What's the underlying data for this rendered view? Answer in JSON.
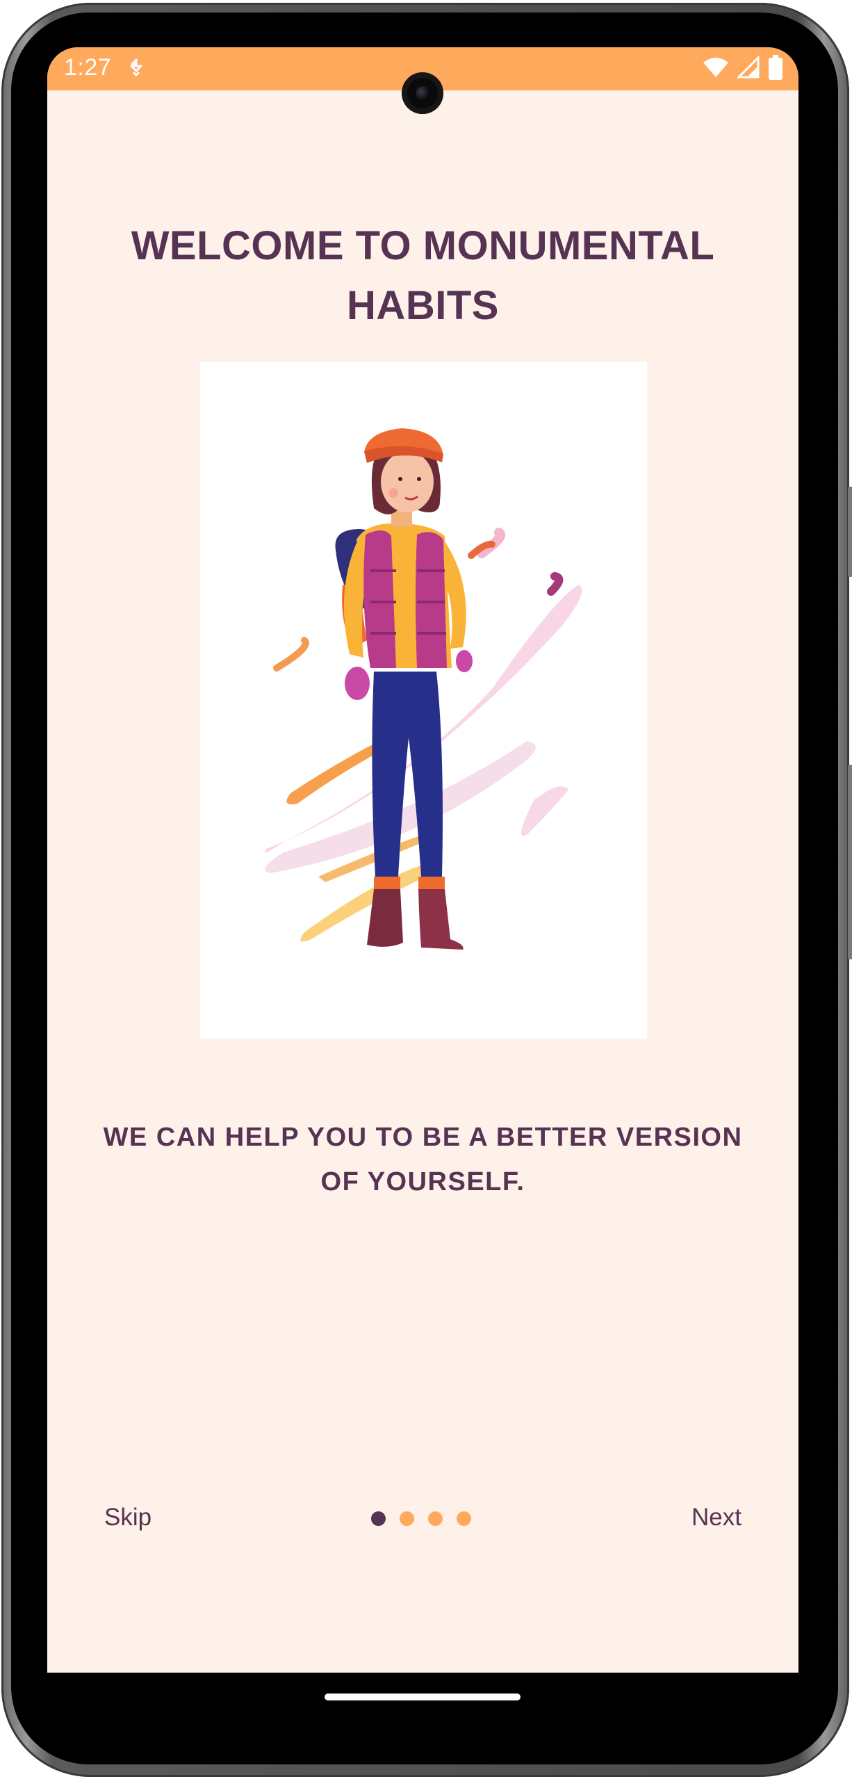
{
  "status_bar": {
    "time": "1:27",
    "background": "#ffa95c",
    "icons": [
      "notification-icon",
      "wifi-icon",
      "signal-icon",
      "battery-icon"
    ]
  },
  "onboarding": {
    "title": "WELCOME TO MONUMENTAL HABITS",
    "subtitle": "WE CAN HELP YOU TO BE A BETTER VERSION OF YOURSELF.",
    "illustration": "hiker-woman-illustration"
  },
  "navigation": {
    "skip_label": "Skip",
    "next_label": "Next",
    "page_indicator": {
      "current": 1,
      "total": 4
    }
  },
  "colors": {
    "background": "#fdf1e9",
    "primary_text": "#573353",
    "accent": "#ffa95c"
  }
}
